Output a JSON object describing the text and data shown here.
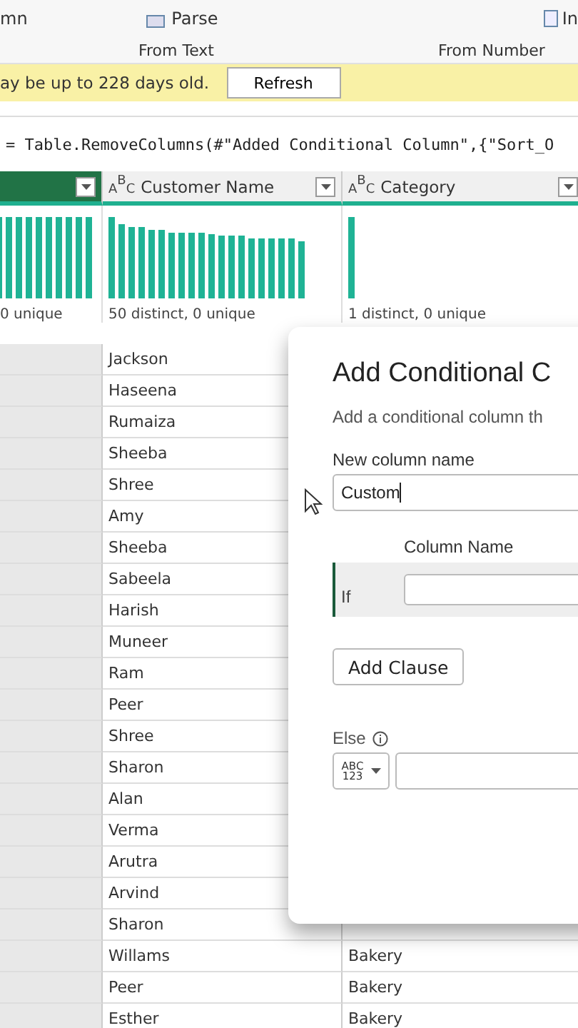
{
  "ribbon": {
    "items": [
      {
        "kind": "text",
        "label": "mn"
      },
      {
        "kind": "parse",
        "label": "Parse"
      },
      {
        "kind": "insert",
        "label": "In"
      }
    ],
    "groups": [
      "From Text",
      "From Number"
    ]
  },
  "warning": {
    "text": "ay be up to 228 days old.",
    "button": "Refresh"
  },
  "formula": "= Table.RemoveColumns(#\"Added Conditional Column\",{\"Sort_O",
  "table": {
    "columns": [
      {
        "selected": true,
        "profile": "0 unique"
      },
      {
        "type_icon": [
          "A",
          "B",
          "C"
        ],
        "label": "Customer Name",
        "selected": false,
        "profile": "50 distinct, 0 unique"
      },
      {
        "type_icon": [
          "A",
          "B",
          "C"
        ],
        "label": "Category",
        "selected": false,
        "profile": "1 distinct, 0 unique"
      }
    ],
    "rows": [
      {
        "name": "Jackson"
      },
      {
        "name": "Haseena"
      },
      {
        "name": "Rumaiza"
      },
      {
        "name": "Sheeba"
      },
      {
        "name": "Shree"
      },
      {
        "name": "Amy"
      },
      {
        "name": "Sheeba"
      },
      {
        "name": "Sabeela"
      },
      {
        "name": "Harish"
      },
      {
        "name": "Muneer"
      },
      {
        "name": "Ram"
      },
      {
        "name": "Peer"
      },
      {
        "name": "Shree"
      },
      {
        "name": "Sharon"
      },
      {
        "name": "Alan"
      },
      {
        "name": "Verma"
      },
      {
        "name": "Arutra"
      },
      {
        "name": "Arvind"
      },
      {
        "name": "Sharon"
      },
      {
        "name": "Willams",
        "category": "Bakery"
      },
      {
        "name": "Peer",
        "category": "Bakery"
      },
      {
        "name": "Esther",
        "category": "Bakery"
      }
    ]
  },
  "dialog": {
    "title": "Add Conditional C",
    "description": "Add a conditional column th",
    "name_label": "New column name",
    "name_value": "Custom",
    "clause_header": "Column Name",
    "if_label": "If",
    "add_clause": "Add Clause",
    "else_label": "Else",
    "type_button": "ABC 123"
  }
}
